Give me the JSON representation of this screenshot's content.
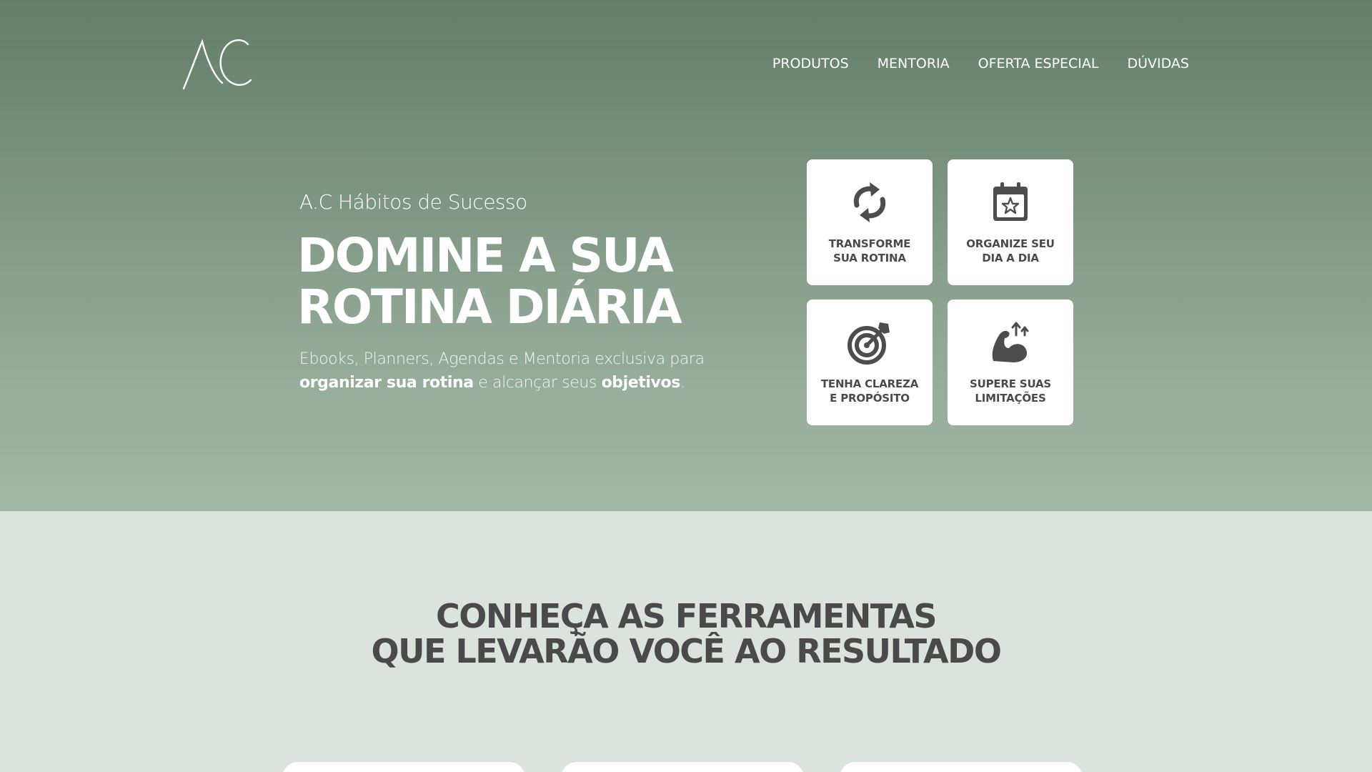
{
  "brand": {
    "logo_text": "AC"
  },
  "nav": {
    "items": [
      {
        "label": "PRODUTOS"
      },
      {
        "label": "MENTORIA"
      },
      {
        "label": "OFERTA ESPECIAL"
      },
      {
        "label": "DÚVIDAS"
      }
    ]
  },
  "hero": {
    "subtitle": "A.C Hábitos de Sucesso",
    "title_line1": "DOMINE A SUA",
    "title_line2": "ROTINA DIÁRIA",
    "desc_part1": "Ebooks, Planners, Agendas e Mentoria exclusiva para",
    "desc_bold1": "organizar sua rotina",
    "desc_part2": " e alcançar seus ",
    "desc_bold2": "objetivos",
    "desc_part3": "."
  },
  "features": [
    {
      "icon": "refresh-arrows-icon",
      "line1": "TRANSFORME",
      "line2": "SUA ROTINA"
    },
    {
      "icon": "calendar-star-icon",
      "line1": "ORGANIZE SEU",
      "line2": "DIA A DIA"
    },
    {
      "icon": "target-arrow-icon",
      "line1": "TENHA CLAREZA",
      "line2": "E PROPÓSITO"
    },
    {
      "icon": "flexed-arm-icon",
      "line1": "SUPERE SUAS",
      "line2": "LIMITAÇÕES"
    }
  ],
  "section": {
    "title_line1": "CONHEÇA AS FERRAMENTAS",
    "title_line2": "QUE LEVARÃO VOCÊ AO RESULTADO"
  },
  "colors": {
    "hero_top": "#637d68",
    "hero_bottom": "#a3b8a6",
    "section_bg": "#dbe4dc",
    "text_dark": "#4a4a4a",
    "icon_dark": "#4d4d4d"
  }
}
